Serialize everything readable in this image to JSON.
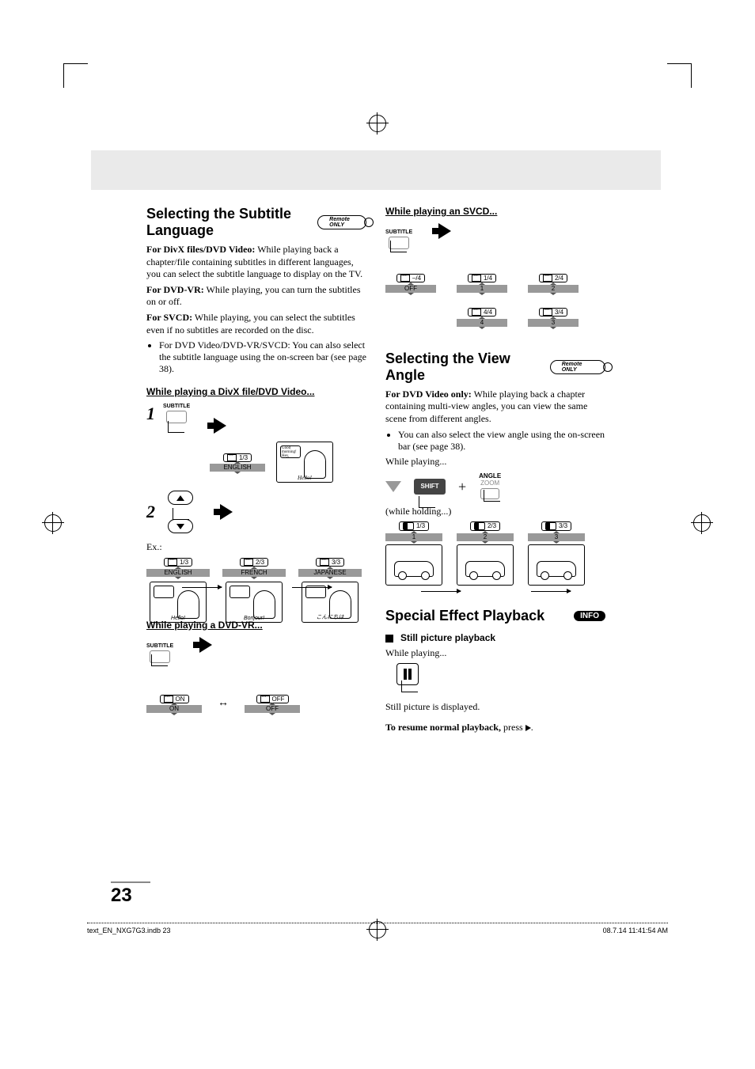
{
  "page_number": "23",
  "footer": {
    "left": "text_EN_NXG7G3.indb   23",
    "right": "08.7.14   11:41:54 AM"
  },
  "remote_label": "Remote ONLY",
  "info_label": "INFO",
  "left": {
    "h1": "Selecting the Subtitle Language",
    "p1_bold": "For DivX files/DVD Video:",
    "p1": " While playing back a chapter/file containing subtitles in different languages, you can select the subtitle language to display on the TV.",
    "p2_bold": "For DVD-VR:",
    "p2": " While playing, you can turn the subtitles on or off.",
    "p3_bold": "For SVCD:",
    "p3": " While playing, you can select the subtitles even if no subtitles are recorded on the disc.",
    "bullet1": "For DVD Video/DVD-VR/SVCD: You can also select the subtitle language using the on-screen bar (see page 38).",
    "sub_h_divx": "While playing a DivX file/DVD Video...",
    "subtitle_btn": "SUBTITLE",
    "osd_step1": {
      "frac": "1/3",
      "lang": "ENGLISH"
    },
    "speech1": "Good morning! Hey, what's up?",
    "hello": "Hello!",
    "ex_label": "Ex.:",
    "examples": [
      {
        "frac": "1/3",
        "lang": "ENGLISH",
        "cap": "Hello!"
      },
      {
        "frac": "2/3",
        "lang": "FRENCH",
        "cap": "Bonjour!"
      },
      {
        "frac": "3/3",
        "lang": "JAPANESE",
        "cap": "こんにちは"
      }
    ],
    "sub_h_vr": "While playing a DVD-VR...",
    "vr": {
      "a_top": "ON",
      "a_bar": "ON",
      "b_top": "OFF",
      "b_bar": "OFF"
    }
  },
  "right": {
    "sub_h_svcd": "While playing an SVCD...",
    "svcd": [
      {
        "top": "–/4",
        "bar": "OFF"
      },
      {
        "top": "1/4",
        "bar": "1"
      },
      {
        "top": "2/4",
        "bar": "2"
      },
      {
        "top": "4/4",
        "bar": "4"
      },
      {
        "top": "3/4",
        "bar": "3"
      }
    ],
    "h2": "Selecting the View Angle",
    "va_p1_bold": "For DVD Video only:",
    "va_p1": " While playing back a chapter containing multi-view angles, you can view the same scene from different angles.",
    "va_bullet": "You can also select the view angle using the on-screen bar (see page 38).",
    "while_play": "While playing...",
    "shift": "SHIFT",
    "angle_lbl": "ANGLE",
    "zoom_lbl": "ZOOM",
    "while_hold": "(while holding...)",
    "angles": [
      {
        "frac": "1/3",
        "bar": "1"
      },
      {
        "frac": "2/3",
        "bar": "2"
      },
      {
        "frac": "3/3",
        "bar": "3"
      }
    ],
    "h3": "Special Effect Playback",
    "still_h": "Still picture playback",
    "still_p1": "While playing...",
    "still_p2": "Still picture is displayed.",
    "resume_bold": "To resume normal playback,",
    "resume_rest": " press "
  }
}
